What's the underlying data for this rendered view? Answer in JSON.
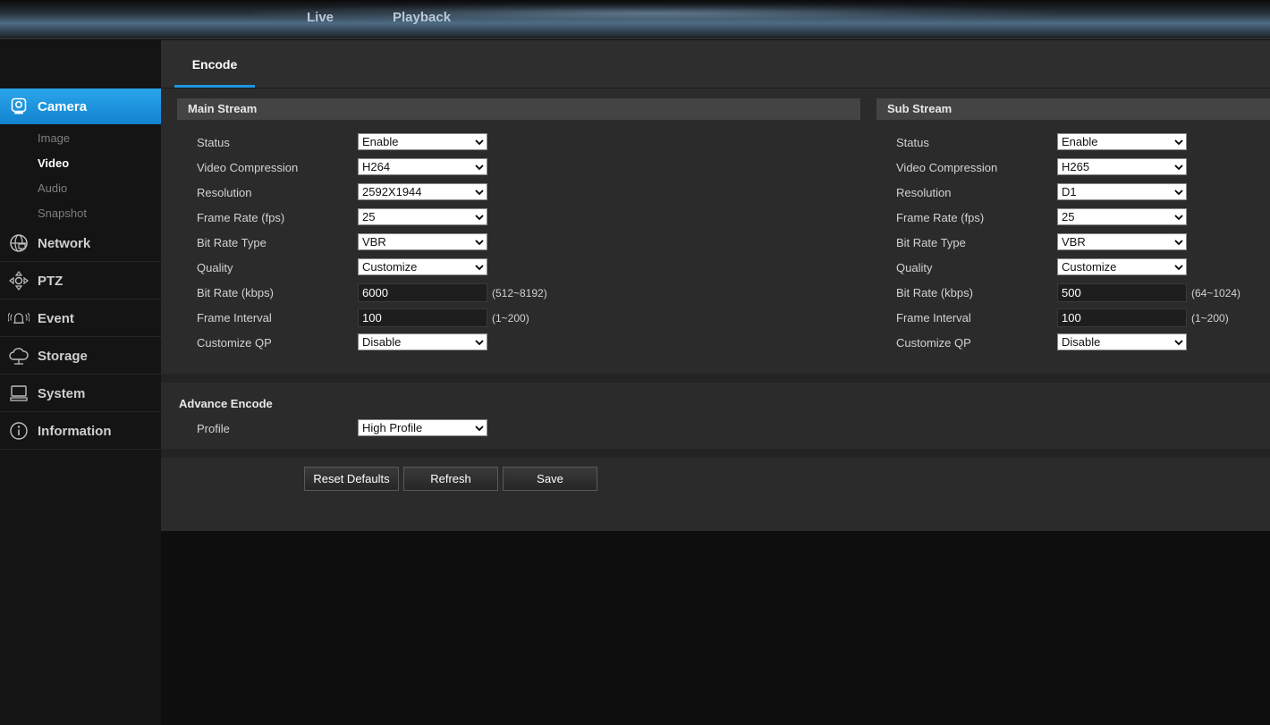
{
  "topnav": {
    "live": "Live",
    "playback": "Playback"
  },
  "sidebar": {
    "camera": "Camera",
    "camera_sub": [
      "Image",
      "Video",
      "Audio",
      "Snapshot"
    ],
    "network": "Network",
    "ptz": "PTZ",
    "event": "Event",
    "storage": "Storage",
    "system": "System",
    "information": "Information"
  },
  "tab": {
    "encode": "Encode"
  },
  "labels": {
    "status": "Status",
    "video_compression": "Video Compression",
    "resolution": "Resolution",
    "frame_rate": "Frame Rate (fps)",
    "bit_rate_type": "Bit Rate Type",
    "quality": "Quality",
    "bit_rate": "Bit Rate (kbps)",
    "frame_interval": "Frame Interval",
    "customize_qp": "Customize QP",
    "profile": "Profile"
  },
  "main_stream": {
    "title": "Main Stream",
    "status": "Enable",
    "video_compression": "H264",
    "resolution": "2592X1944",
    "frame_rate": "25",
    "bit_rate_type": "VBR",
    "quality": "Customize",
    "bit_rate": "6000",
    "bit_rate_range": "(512~8192)",
    "frame_interval": "100",
    "frame_interval_range": "(1~200)",
    "customize_qp": "Disable"
  },
  "sub_stream": {
    "title": "Sub Stream",
    "status": "Enable",
    "video_compression": "H265",
    "resolution": "D1",
    "frame_rate": "25",
    "bit_rate_type": "VBR",
    "quality": "Customize",
    "bit_rate": "500",
    "bit_rate_range": "(64~1024)",
    "frame_interval": "100",
    "frame_interval_range": "(1~200)",
    "customize_qp": "Disable"
  },
  "advance": {
    "title": "Advance Encode",
    "profile": "High Profile"
  },
  "buttons": {
    "reset": "Reset Defaults",
    "refresh": "Refresh",
    "save": "Save"
  },
  "colors": {
    "accent": "#1f95e0",
    "panel": "#2b2b2b",
    "header": "#444444"
  }
}
